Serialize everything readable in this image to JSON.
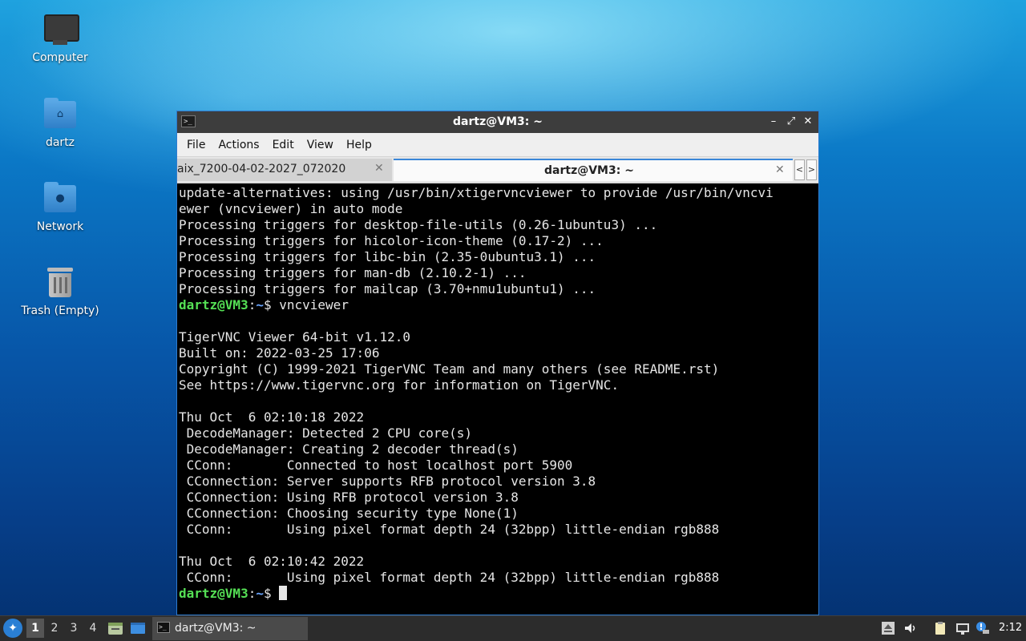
{
  "desktop": {
    "icons": [
      {
        "label": "Computer",
        "icon": "computer-icon"
      },
      {
        "label": "dartz",
        "icon": "home-folder-icon"
      },
      {
        "label": "Network",
        "icon": "network-folder-icon"
      },
      {
        "label": "Trash (Empty)",
        "icon": "trash-icon"
      }
    ]
  },
  "window": {
    "title": "dartz@VM3: ~",
    "controls": {
      "minimize": "–",
      "maximize": "⤢",
      "close": "✕"
    },
    "menu": [
      "File",
      "Actions",
      "Edit",
      "View",
      "Help"
    ],
    "tabs": [
      {
        "label": "aix_7200-04-02-2027_072020",
        "active": false
      },
      {
        "label": "dartz@VM3: ~",
        "active": true
      }
    ],
    "tab_scroll": {
      "left": "<",
      "right": ">"
    },
    "terminal": {
      "prompt_user": "dartz@VM3",
      "prompt_sep": ":",
      "prompt_path": "~",
      "prompt_sym": "$ ",
      "command": "vncviewer",
      "lines_before": [
        "update-alternatives: using /usr/bin/xtigervncviewer to provide /usr/bin/vncvi",
        "ewer (vncviewer) in auto mode",
        "Processing triggers for desktop-file-utils (0.26-1ubuntu3) ...",
        "Processing triggers for hicolor-icon-theme (0.17-2) ...",
        "Processing triggers for libc-bin (2.35-0ubuntu3.1) ...",
        "Processing triggers for man-db (2.10.2-1) ...",
        "Processing triggers for mailcap (3.70+nmu1ubuntu1) ..."
      ],
      "lines_after": [
        "",
        "TigerVNC Viewer 64-bit v1.12.0",
        "Built on: 2022-03-25 17:06",
        "Copyright (C) 1999-2021 TigerVNC Team and many others (see README.rst)",
        "See https://www.tigervnc.org for information on TigerVNC.",
        "",
        "Thu Oct  6 02:10:18 2022",
        " DecodeManager: Detected 2 CPU core(s)",
        " DecodeManager: Creating 2 decoder thread(s)",
        " CConn:       Connected to host localhost port 5900",
        " CConnection: Server supports RFB protocol version 3.8",
        " CConnection: Using RFB protocol version 3.8",
        " CConnection: Choosing security type None(1)",
        " CConn:       Using pixel format depth 24 (32bpp) little-endian rgb888",
        "",
        "Thu Oct  6 02:10:42 2022",
        " CConn:       Using pixel format depth 24 (32bpp) little-endian rgb888"
      ]
    }
  },
  "taskbar": {
    "workspaces": [
      "1",
      "2",
      "3",
      "4"
    ],
    "current_workspace": "1",
    "task_label": "dartz@VM3: ~",
    "clock": "2:12",
    "tray_icons": [
      "eject-icon",
      "volume-icon",
      "clipboard-icon",
      "network-icon",
      "notification-icon"
    ]
  },
  "colors": {
    "prompt_user": "#55e055",
    "prompt_path": "#6aa6ff",
    "accent": "#2e7bd0"
  }
}
